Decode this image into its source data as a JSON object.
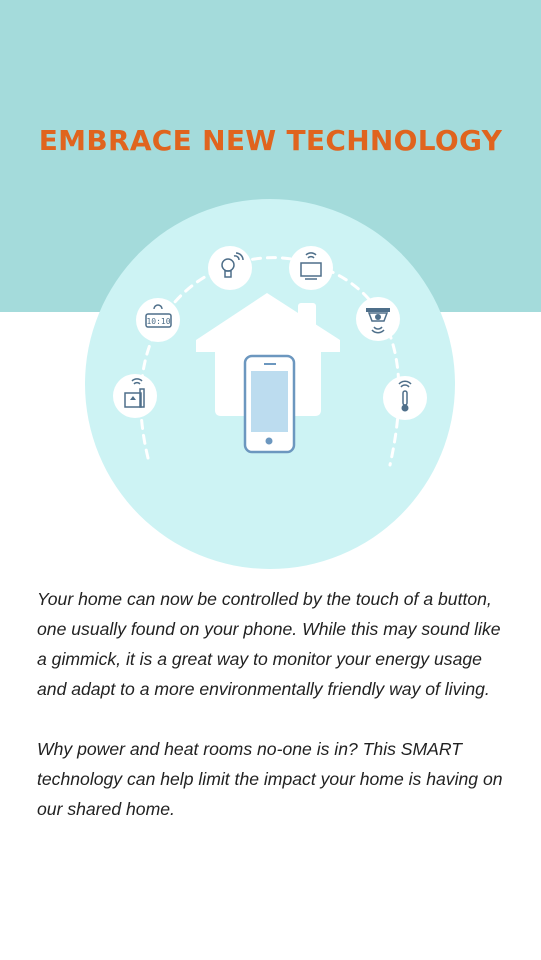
{
  "colors": {
    "top_band": "#a4dbdb",
    "title": "#e0641e",
    "circle": "#cdf3f4",
    "house": "#ffffff",
    "phone_outline": "#6c97bf",
    "phone_screen": "#bcdcef",
    "icon_stroke": "#4f6f8a"
  },
  "header": {
    "title": "EMBRACE NEW TECHNOLOGY"
  },
  "illustration": {
    "icons": [
      "router-icon",
      "clock-icon",
      "light-bulb-icon",
      "tv-icon",
      "security-camera-icon",
      "thermometer-icon"
    ],
    "clock_display": "10:10"
  },
  "content": {
    "paragraph_1": "Your home can now be controlled by the touch of a button, one usually found on your phone. While this may sound like a gimmick, it is a great way to monitor your energy usage and adapt to a more environmentally friendly way of living.",
    "paragraph_2": "Why power and heat rooms no-one is in? This SMART technology can help limit the impact your home is having on our shared home."
  }
}
